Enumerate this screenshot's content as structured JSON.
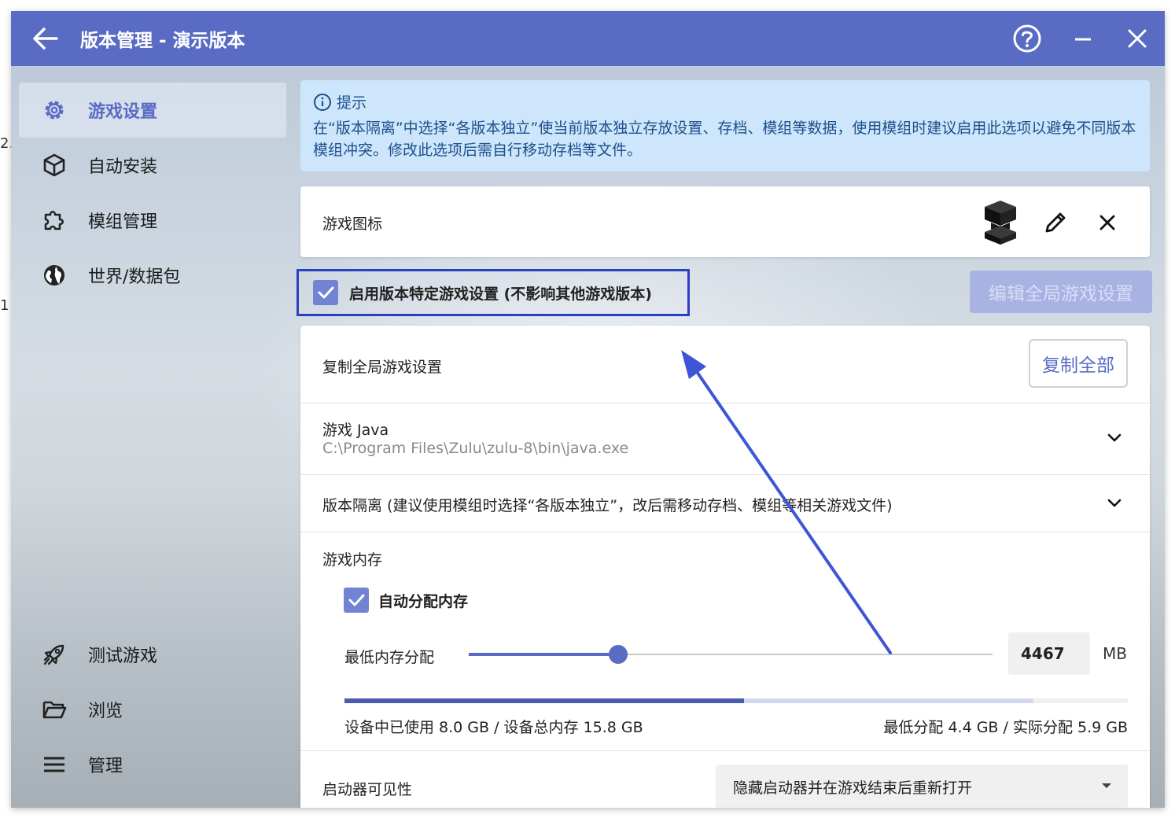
{
  "window": {
    "title": "版本管理 - 演示版本"
  },
  "sidebar": {
    "items": [
      {
        "label": "游戏设置",
        "icon": "gear-icon",
        "active": true
      },
      {
        "label": "自动安装",
        "icon": "cube-icon"
      },
      {
        "label": "模组管理",
        "icon": "puzzle-icon"
      },
      {
        "label": "世界/数据包",
        "icon": "globe-icon"
      },
      {
        "label": "测试游戏",
        "icon": "rocket-icon"
      },
      {
        "label": "浏览",
        "icon": "folder-icon"
      },
      {
        "label": "管理",
        "icon": "menu-icon"
      }
    ]
  },
  "tip": {
    "title": "提示",
    "body": "在“版本隔离”中选择“各版本独立”使当前版本独立存放设置、存档、模组等数据，使用模组时建议启用此选项以避免不同版本模组冲突。修改此选项后需自行移动存档等文件。"
  },
  "game_icon": {
    "label": "游戏图标"
  },
  "version_specific": {
    "label": "启用版本特定游戏设置 (不影响其他游戏版本)",
    "checked": true,
    "edit_global_button": "编辑全局游戏设置"
  },
  "settings": {
    "copy_global_label": "复制全局游戏设置",
    "copy_all_button": "复制全部",
    "java_label": "游戏 Java",
    "java_path": "C:\\Program Files\\Zulu\\zulu-8\\bin\\java.exe",
    "isolation_label": "版本隔离 (建议使用模组时选择“各版本独立”，改后需移动存档、模组等相关游戏文件)",
    "memory_label": "游戏内存",
    "auto_memory_label": "自动分配内存",
    "auto_memory_checked": true,
    "min_memory_label": "最低内存分配",
    "min_memory_value": "4467",
    "memory_unit": "MB",
    "slider_fraction": 0.285,
    "used_fraction": 0.51,
    "allocated_fraction": 0.88,
    "used_text": "设备中已使用 8.0 GB / 设备总内存 15.8 GB",
    "alloc_text": "最低分配 4.4 GB / 实际分配 5.9 GB",
    "launcher_visibility_label": "启动器可见性",
    "launcher_visibility_value": "隐藏启动器并在游戏结束后重新打开"
  },
  "edge_texts": [
    "2.",
    "1"
  ],
  "colors": {
    "accent": "#5a6bc4",
    "highlight": "#2b3fc2",
    "tip_bg": "#cde6fb"
  }
}
